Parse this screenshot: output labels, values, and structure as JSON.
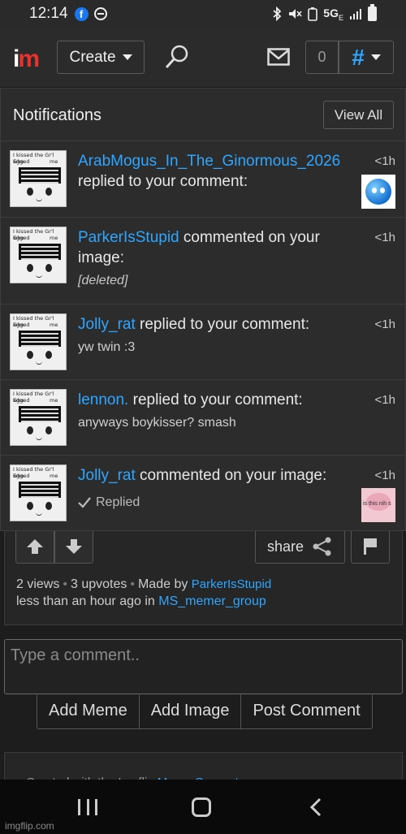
{
  "status_bar": {
    "time": "12:14",
    "network": "5G",
    "network_sub": "E",
    "fb_letter": "f"
  },
  "header": {
    "logo_i": "i",
    "logo_m": "m",
    "create_label": "Create",
    "notification_count": "0"
  },
  "notifications": {
    "title": "Notifications",
    "view_all_label": "View All",
    "avatar_caption_line1": "I kissed the Gr'l who",
    "avatar_caption_line2": "Egged",
    "avatar_caption_line3": "me",
    "items": [
      {
        "user": "ArabMogus_In_The_Ginormous_2026",
        "action": " replied to your comment:",
        "sub": "",
        "time": "<1h",
        "thumb": "blue-emoji"
      },
      {
        "user": "ParkerIsStupid",
        "action": " commented on your image:",
        "sub": "[deleted]",
        "time": "<1h",
        "thumb": ""
      },
      {
        "user": "Jolly_rat",
        "action": " replied to your comment:",
        "sub": "yw twin :3",
        "time": "<1h",
        "thumb": ""
      },
      {
        "user": "lennon.",
        "action": " replied to your comment:",
        "sub": "anyways boykisser? smash",
        "time": "<1h",
        "thumb": ""
      },
      {
        "user": "Jolly_rat",
        "action": " commented on your image:",
        "sub": "Replied",
        "time": "<1h",
        "thumb": "pink-meme",
        "thumb_text": "is this nih s"
      }
    ]
  },
  "post": {
    "share_label": "share",
    "views": "2 views",
    "upvotes": "3 upvotes",
    "made_by_prefix": "Made by ",
    "author": "ParkerIsStupid",
    "time_prefix": "less than an hour ago in ",
    "stream": "MS_memer_group"
  },
  "comment": {
    "placeholder": "Type a comment..",
    "add_meme": "Add Meme",
    "add_image": "Add Image",
    "post_comment": "Post Comment"
  },
  "generator": {
    "prefix": "Created with the Imgflip ",
    "link": "Meme Generator"
  },
  "watermark": "imgflip.com"
}
